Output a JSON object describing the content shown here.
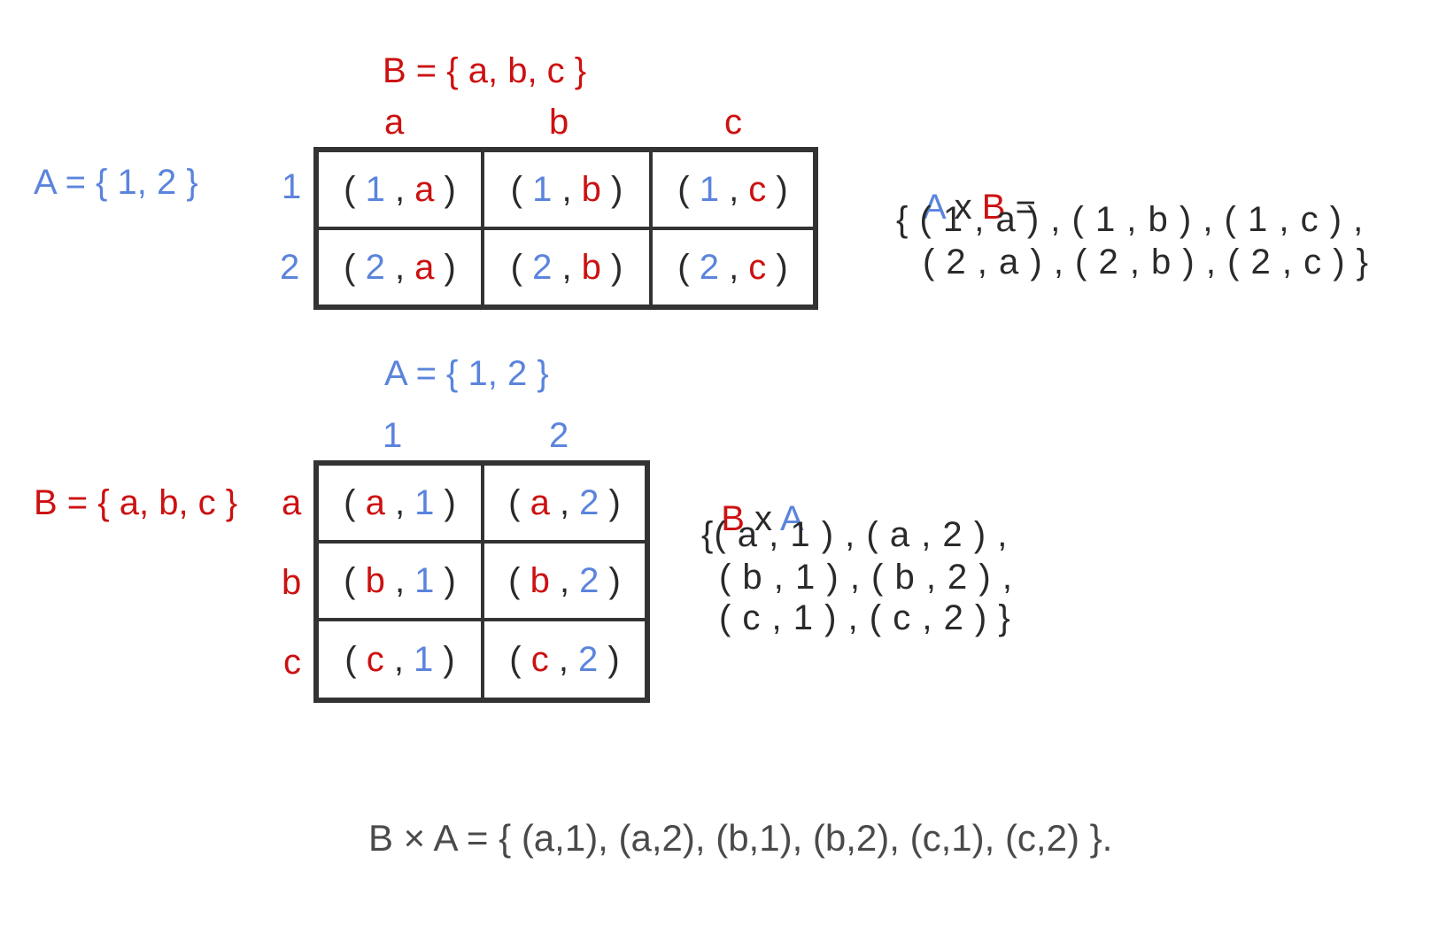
{
  "colors": {
    "set_a": "#5b84dd",
    "set_b": "#cc1111",
    "text": "#2a2a2a"
  },
  "top": {
    "b_def": "B = { a, b, c }",
    "a_def": "A = { 1, 2 }",
    "col_headers": [
      "a",
      "b",
      "c"
    ],
    "row_headers": [
      "1",
      "2"
    ],
    "cells": [
      [
        {
          "first": "1",
          "second": "a"
        },
        {
          "first": "1",
          "second": "b"
        },
        {
          "first": "1",
          "second": "c"
        }
      ],
      [
        {
          "first": "2",
          "second": "a"
        },
        {
          "first": "2",
          "second": "b"
        },
        {
          "first": "2",
          "second": "c"
        }
      ]
    ],
    "product_label": {
      "left": "A",
      "op": "x",
      "right": "B",
      "eq": "="
    },
    "product_lines": [
      "{ ( 1 , a ) , ( 1 , b ) , ( 1 , c ) ,",
      "( 2 , a ) , ( 2 , b ) , ( 2 , c ) }"
    ]
  },
  "bottom": {
    "a_def": "A = { 1, 2 }",
    "b_def": "B = { a, b, c }",
    "col_headers": [
      "1",
      "2"
    ],
    "row_headers": [
      "a",
      "b",
      "c"
    ],
    "cells": [
      [
        {
          "first": "a",
          "second": "1"
        },
        {
          "first": "a",
          "second": "2"
        }
      ],
      [
        {
          "first": "b",
          "second": "1"
        },
        {
          "first": "b",
          "second": "2"
        }
      ],
      [
        {
          "first": "c",
          "second": "1"
        },
        {
          "first": "c",
          "second": "2"
        }
      ]
    ],
    "product_label": {
      "left": "B",
      "op": "x",
      "right": "A"
    },
    "product_lines": [
      "{( a , 1 ) , ( a , 2 ) ,",
      "( b , 1 ) , ( b , 2 ) ,",
      "( c , 1 ) , ( c , 2 ) }"
    ]
  },
  "final_statement": "B × A = { (a,1), (a,2), (b,1), (b,2), (c,1), (c,2) }."
}
